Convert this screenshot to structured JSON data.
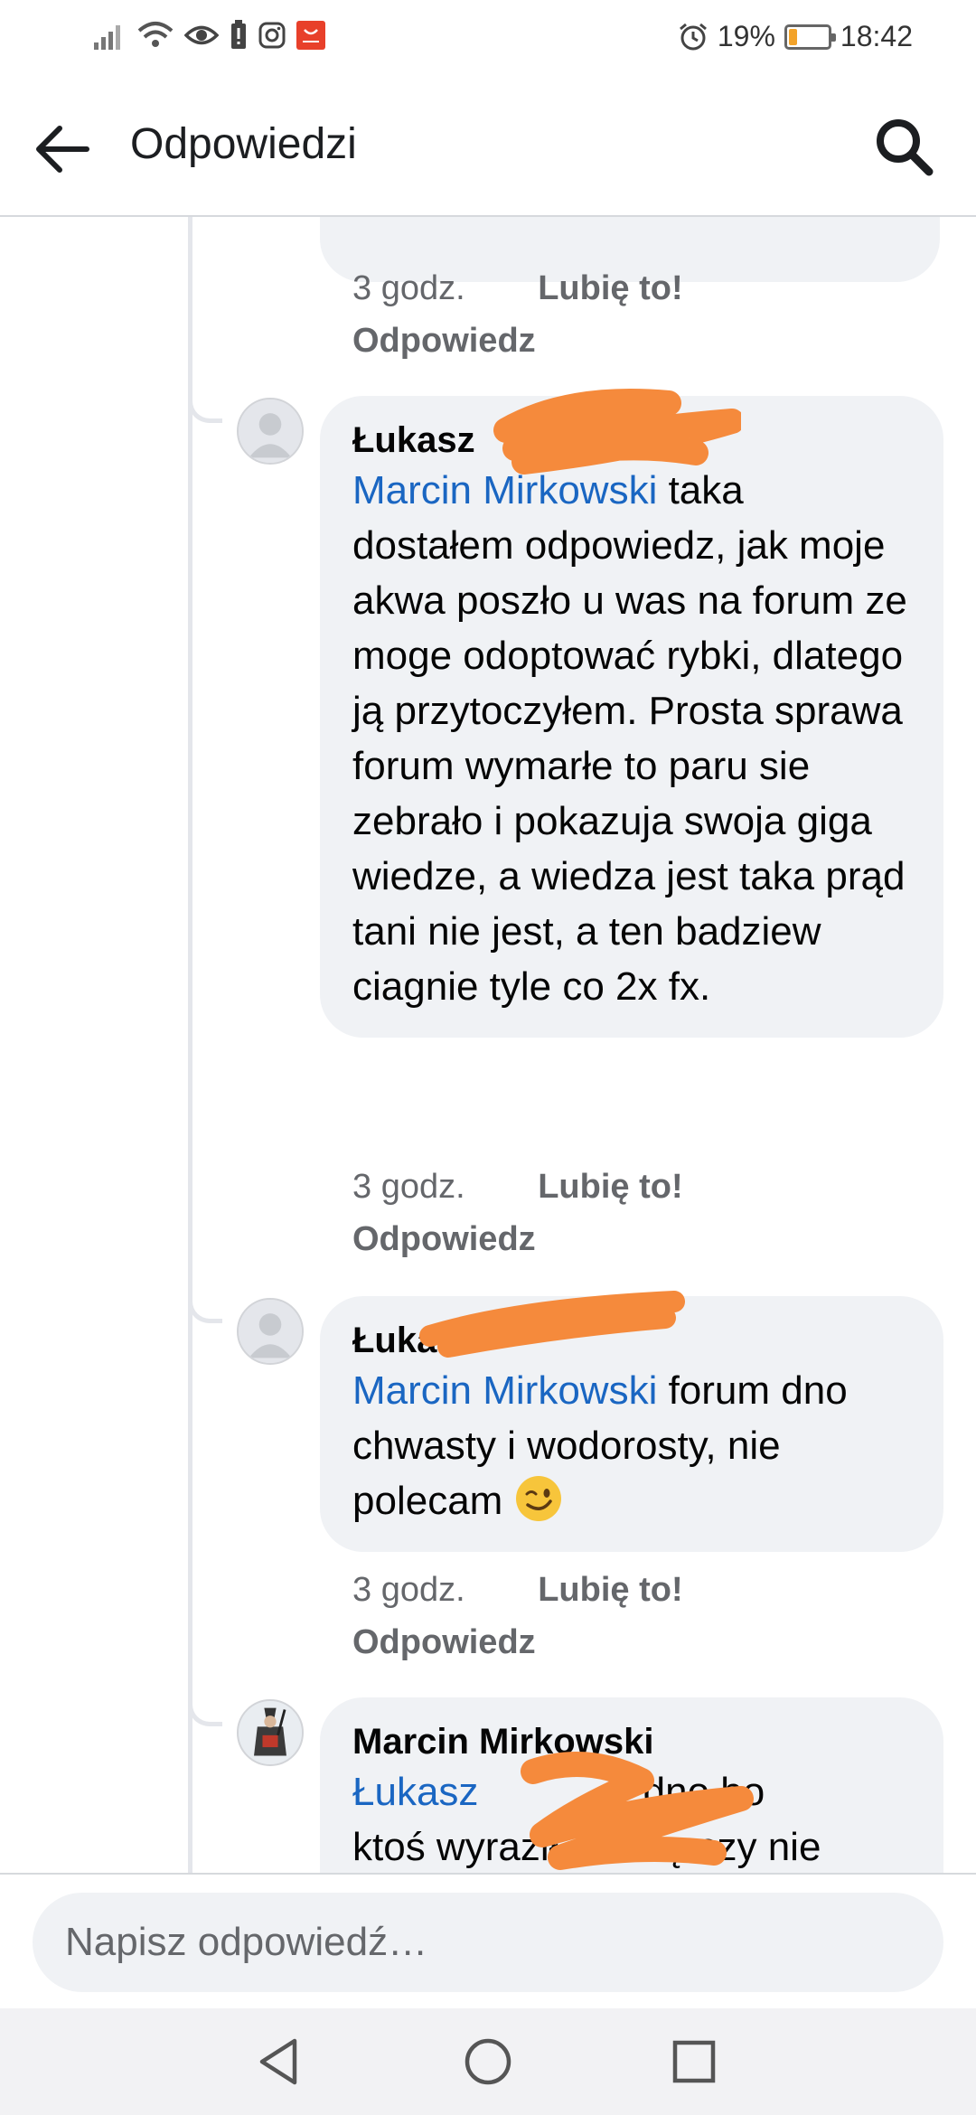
{
  "status_bar": {
    "battery_percent": "19%",
    "battery_level": 0.19,
    "time": "18:42",
    "battery_color": "#f3a32a"
  },
  "header": {
    "title": "Odpowiedzi"
  },
  "comments": [
    {
      "time": "3 godz.",
      "like_label": "Lubię to!",
      "reply_label": "Odpowiedz"
    },
    {
      "author": "Łukasz",
      "mention": "Marcin Mirkowski",
      "text": " taka dostałem odpowiedz, jak moje akwa poszło u was na forum ze moge odoptować rybki, dlatego ją przytoczyłem. Prosta sprawa forum wymarłe to paru sie zebrało i pokazuja swoja giga wiedze, a wiedza jest taka prąd tani nie jest, a ten badziew ciagnie tyle co 2x fx.",
      "time": "3 godz.",
      "like_label": "Lubię to!",
      "reply_label": "Odpowiedz"
    },
    {
      "author": "Łukasz",
      "mention": "Marcin Mirkowski",
      "text": " forum dno chwasty i wodorosty, nie polecam",
      "emoji": "winking-face",
      "time": "3 godz.",
      "like_label": "Lubię to!",
      "reply_label": "Odpowiedz"
    },
    {
      "author": "Marcin Mirkowski",
      "mention": "Łukasz",
      "text_line1_end": "dno bo",
      "text_line2": "ktoś wyraził obawę czy nie"
    }
  ],
  "compose": {
    "placeholder": "Napisz odpowiedź…"
  },
  "colors": {
    "mention": "#1a66c2",
    "bubble": "#f0f2f5",
    "meta": "#65676b",
    "redaction": "#f58a3c"
  }
}
